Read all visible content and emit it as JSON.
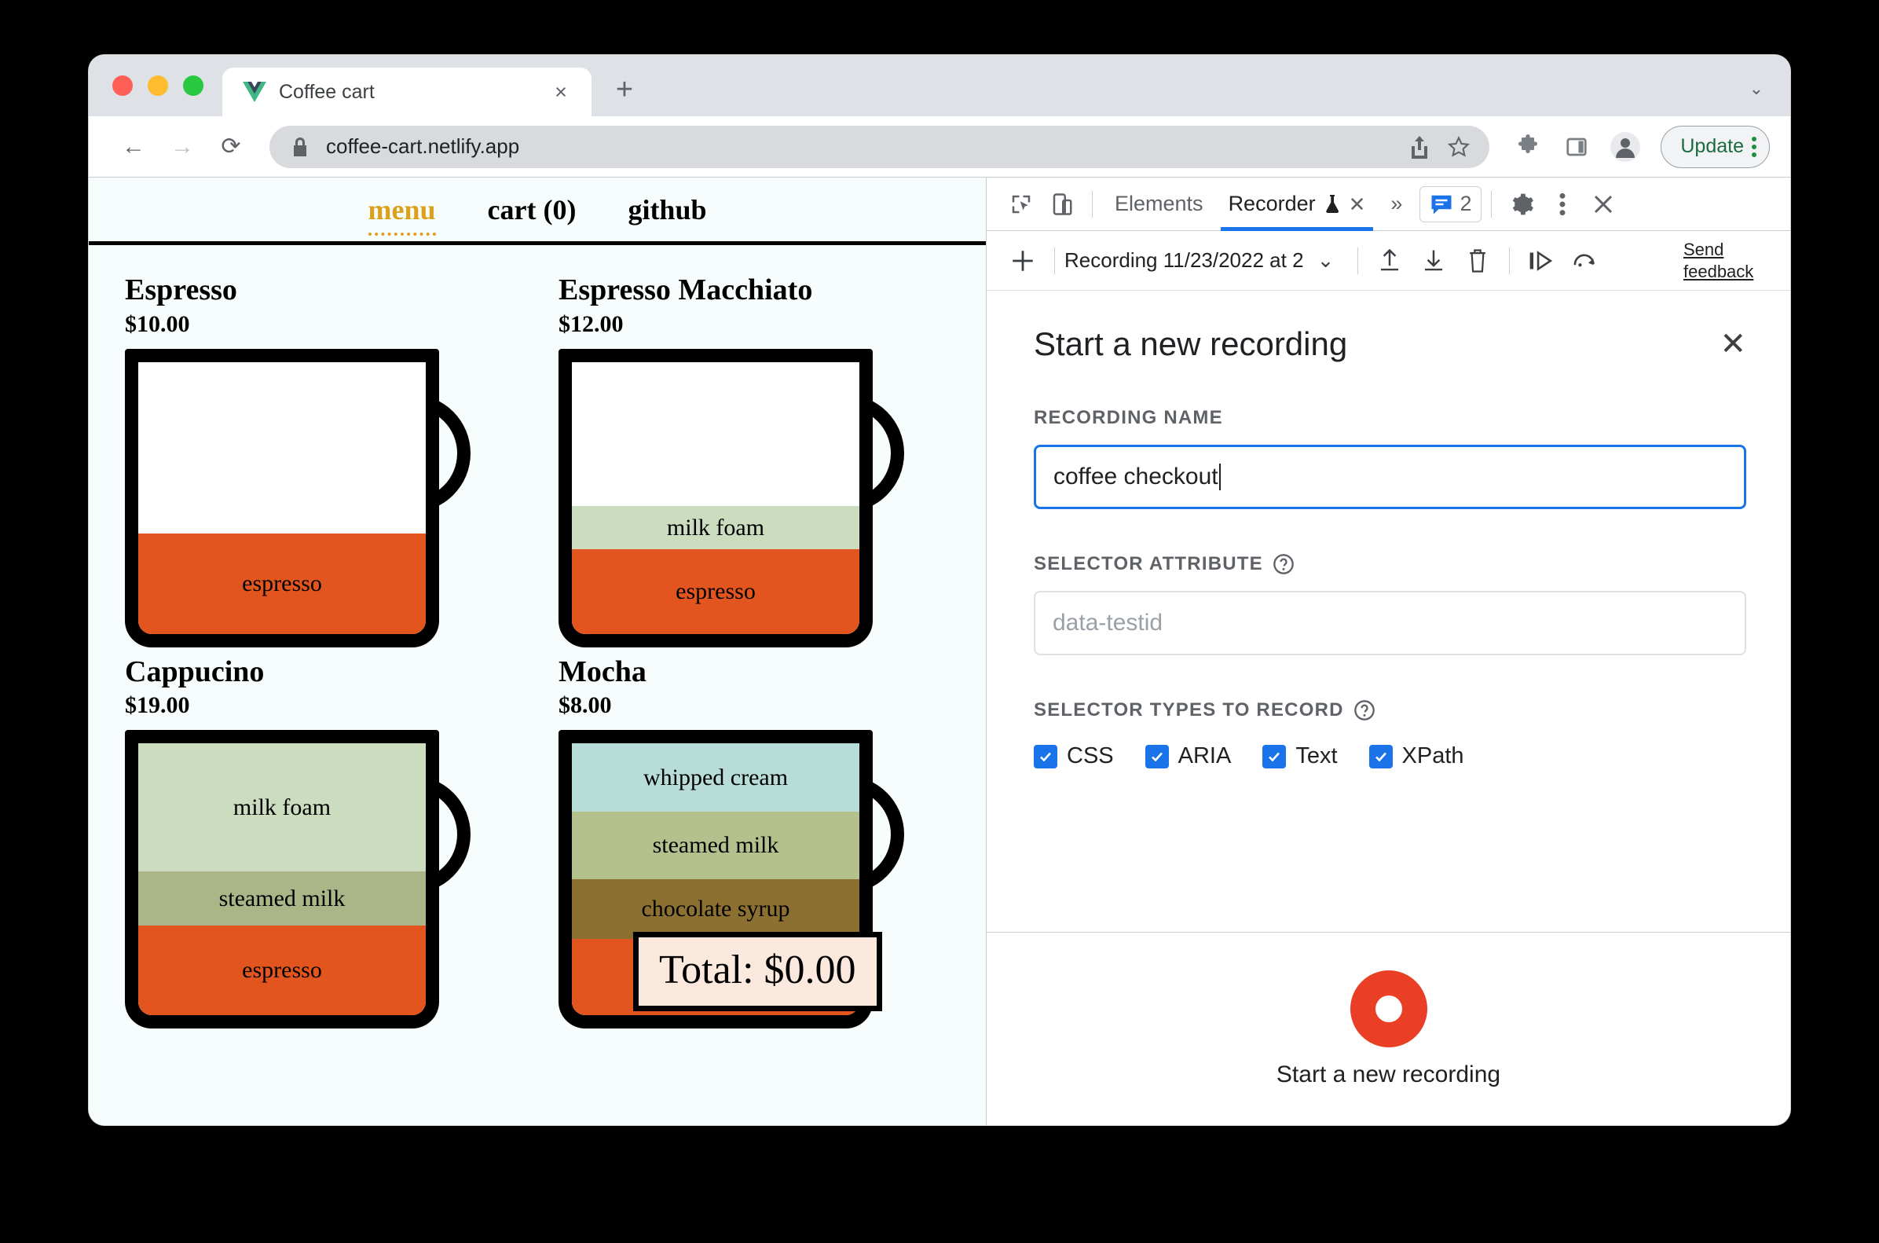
{
  "browser": {
    "tab": {
      "title": "Coffee cart",
      "favicon": "vue-logo-icon",
      "close": "×"
    },
    "new_tab_label": "+",
    "tabstrip_chevron": "⌄",
    "nav": {
      "back": "←",
      "forward": "→",
      "reload": "⟳"
    },
    "omnibox": {
      "lock": "lock-icon",
      "url": "coffee-cart.netlify.app",
      "share": "share-icon",
      "bookmark": "star-icon"
    },
    "toolbar_icons": [
      "extensions-puzzle-icon",
      "side-panel-icon",
      "profile-avatar-icon"
    ],
    "update": {
      "label": "Update",
      "menu": "kebab-menu-icon"
    }
  },
  "page": {
    "nav": [
      {
        "label": "menu",
        "active": true
      },
      {
        "label": "cart (0)",
        "active": false
      },
      {
        "label": "github",
        "active": false
      }
    ],
    "products": [
      {
        "name": "Espresso",
        "price": "$10.00",
        "layers": [
          {
            "label": "",
            "color": "#ffffff",
            "height": 63
          },
          {
            "label": "espresso",
            "color": "#e2551f",
            "height": 37
          }
        ]
      },
      {
        "name": "Espresso Macchiato",
        "price": "$12.00",
        "layers": [
          {
            "label": "",
            "color": "#ffffff",
            "height": 53
          },
          {
            "label": "milk foam",
            "color": "#cbdcbf",
            "height": 16
          },
          {
            "label": "espresso",
            "color": "#e2551f",
            "height": 31
          }
        ]
      },
      {
        "name": "Cappucino",
        "price": "$19.00",
        "layers": [
          {
            "label": "milk foam",
            "color": "#cbdcbf",
            "height": 47
          },
          {
            "label": "steamed milk",
            "color": "#aab687",
            "height": 20
          },
          {
            "label": "espresso",
            "color": "#e2551f",
            "height": 33
          }
        ]
      },
      {
        "name": "Mocha",
        "price": "$8.00",
        "layers": [
          {
            "label": "whipped cream",
            "color": "#b8ddd8",
            "height": 25
          },
          {
            "label": "steamed milk",
            "color": "#b5c18d",
            "height": 25
          },
          {
            "label": "chocolate syrup",
            "color": "#8b7032",
            "height": 22
          },
          {
            "label": "espresso",
            "color": "#e2551f",
            "height": 28
          }
        ]
      }
    ],
    "total": "Total: $0.00"
  },
  "devtools": {
    "tabs": [
      {
        "label": "Elements",
        "active": false
      },
      {
        "label": "Recorder",
        "active": true,
        "experimental": true,
        "close": "✕"
      }
    ],
    "overflow": "»",
    "messages_count": "2",
    "icons": {
      "inspect": "inspect-element-icon",
      "device": "device-toolbar-icon",
      "messages": "messages-icon",
      "settings": "gear-icon",
      "more": "kebab-menu-icon",
      "close": "close-icon"
    },
    "recorder_toolbar": {
      "add": "+",
      "recording_name": "Recording 11/23/2022 at 2",
      "dropdown": "⌄",
      "export": "export-icon",
      "import": "import-icon",
      "delete": "trash-icon",
      "replay": "replay-step-icon",
      "replay_speed": "replay-speed-icon",
      "feedback": "Send feedback"
    },
    "recorder_form": {
      "title": "Start a new recording",
      "close": "✕",
      "recording_name_label": "Recording name",
      "recording_name_value": "coffee checkout",
      "selector_attribute_label": "Selector attribute",
      "selector_attribute_placeholder": "data-testid",
      "selector_attribute_value": "",
      "selector_types_label": "Selector types to record",
      "selector_types": [
        {
          "label": "CSS",
          "checked": true
        },
        {
          "label": "ARIA",
          "checked": true
        },
        {
          "label": "Text",
          "checked": true
        },
        {
          "label": "XPath",
          "checked": true
        }
      ],
      "start_button_label": "Start a new recording"
    }
  },
  "colors": {
    "accent_blue": "#1a73e8",
    "record_red": "#ea3f26",
    "espresso": "#e2551f",
    "menu_gold": "#dda01b",
    "page_bg": "#f7fdfd",
    "total_badge_bg": "#fbe9dd"
  }
}
